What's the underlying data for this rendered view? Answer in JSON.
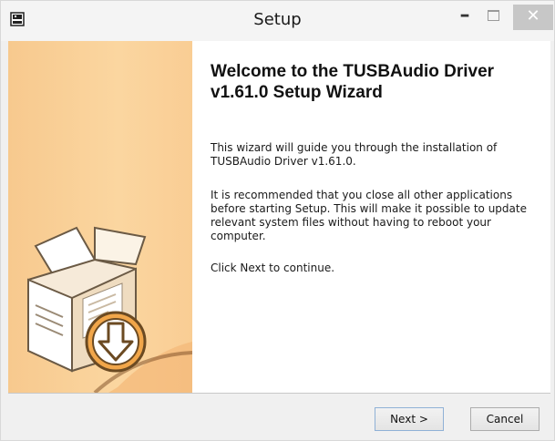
{
  "window": {
    "title": "Setup",
    "minimize_glyph": "–",
    "close_glyph": "✕"
  },
  "icons": {
    "app": "installer-app-icon",
    "minimize": "minimize-icon",
    "maximize": "maximize-icon",
    "close": "close-icon",
    "illustration": "installer-box-download-illustration"
  },
  "wizard": {
    "heading": "Welcome to the TUSBAudio Driver v1.61.0 Setup Wizard",
    "paragraphs": [
      "This wizard will guide you through the installation of TUSBAudio Driver v1.61.0.",
      "It is recommended that you close all other applications before starting Setup. This will make it possible to update relevant system files without having to reboot your computer.",
      "Click Next to continue."
    ]
  },
  "buttons": {
    "next": "Next >",
    "cancel": "Cancel"
  },
  "colors": {
    "side_panel": "#f9cf96",
    "close_button": "#c7c7c7",
    "window_bg": "#f0f0f0"
  }
}
